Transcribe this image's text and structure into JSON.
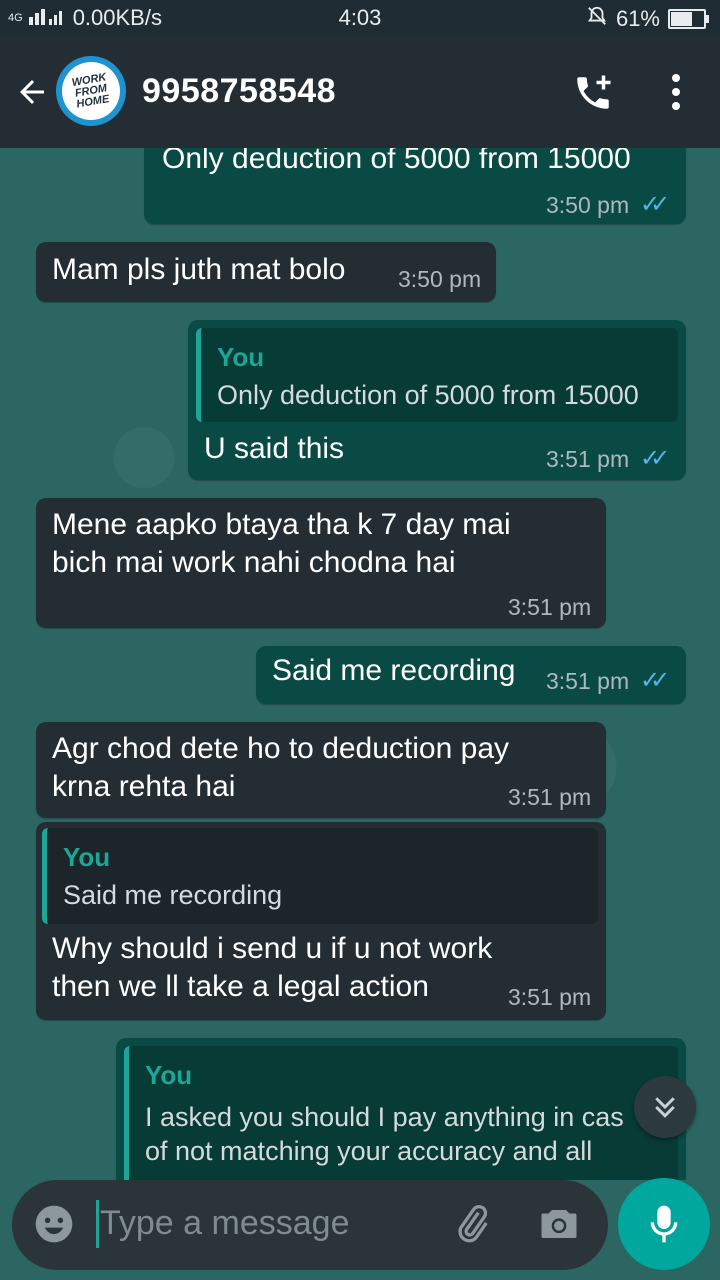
{
  "status_bar": {
    "network": "4G",
    "speed": "0.00KB/s",
    "time": "4:03",
    "battery": "61%",
    "battery_level": 0.61
  },
  "header": {
    "avatar_text": "WORK FROM HOME",
    "contact": "9958758548"
  },
  "messages": {
    "m1": {
      "text": "Only deduction of 5000 from 15000",
      "time": "3:50 pm"
    },
    "m2": {
      "text": "Mam pls juth mat bolo",
      "time": "3:50 pm"
    },
    "m3": {
      "quote_name": "You",
      "quote_text": "Only deduction of 5000 from 15000",
      "text": "U said this",
      "time": "3:51 pm"
    },
    "m4": {
      "line1": "Mene aapko btaya tha k 7 day mai",
      "line2": "bich mai work nahi chodna hai",
      "time": "3:51 pm"
    },
    "m5": {
      "text": "Said me recording",
      "time": "3:51 pm"
    },
    "m6": {
      "line1": "Agr chod dete ho to deduction pay",
      "line2": "krna rehta hai",
      "time": "3:51 pm"
    },
    "m7": {
      "quote_name": "You",
      "quote_text": "Said me recording",
      "line1": "Why should i send u if u not work",
      "line2": "then we ll take a legal action",
      "time": "3:51 pm"
    },
    "m8": {
      "quote_name": "You",
      "quote_line1": "I asked you should I pay anything in cas",
      "quote_line2": "of not matching your accuracy and all"
    }
  },
  "composer": {
    "placeholder": "Type a message"
  },
  "colors": {
    "accent": "#00a79d",
    "read_ticks": "#4fb6ec",
    "incoming": "#242d33",
    "outgoing": "#0a4a44"
  }
}
